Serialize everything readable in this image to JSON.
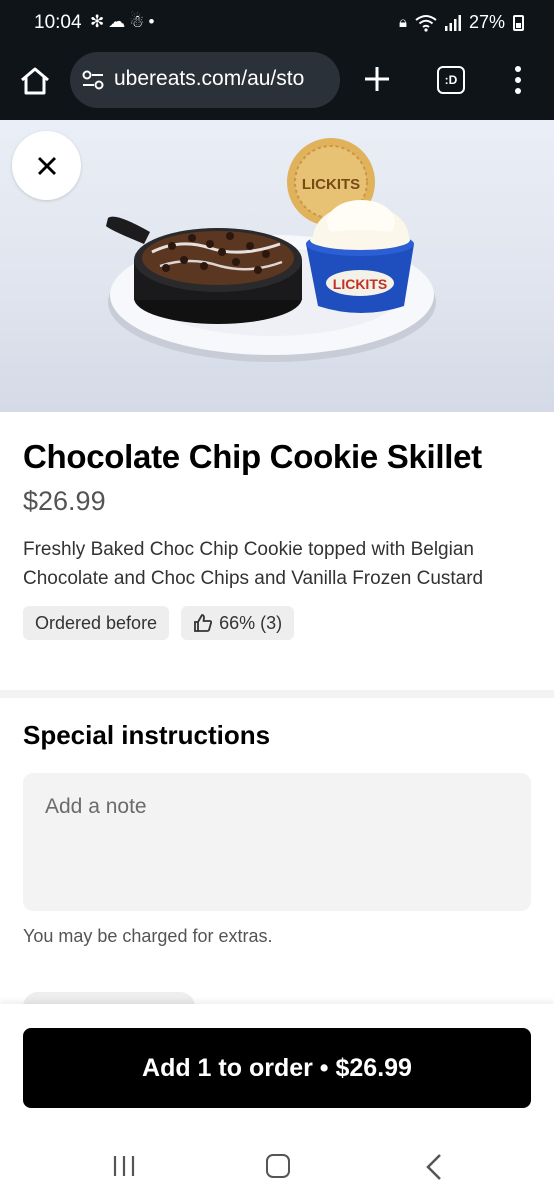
{
  "status_bar": {
    "time": "10:04",
    "left_icons": [
      "fan-icon",
      "cloud-icon",
      "snowman-icon",
      "dot-icon"
    ],
    "battery_percent": "27%",
    "right_icons": [
      "lock-icon",
      "wifi-icon",
      "signal-icon",
      "battery-icon"
    ]
  },
  "browser": {
    "url": "ubereats.com/au/sto",
    "tabs_label": ":D",
    "icons": [
      "home-icon",
      "tune-icon",
      "plus-icon",
      "tabs-icon",
      "more-vert-icon"
    ]
  },
  "product": {
    "title": "Chocolate Chip Cookie Skillet",
    "price": "$26.99",
    "description": "Freshly Baked Choc Chip Cookie topped with Belgian Chocolate and Choc Chips and Vanilla Frozen Custard",
    "tags": {
      "ordered_before": "Ordered before",
      "rating": "66% (3)"
    },
    "brand_logo_text": "LICKITS"
  },
  "special_instructions": {
    "title": "Special instructions",
    "placeholder": "Add a note",
    "helper": "You may be charged for extras."
  },
  "cta": {
    "label": "Add 1 to order • $26.99"
  },
  "colors": {
    "cta_bg": "#000000",
    "chrome_bg": "#0f1419",
    "chip_bg": "#eeeeee"
  }
}
